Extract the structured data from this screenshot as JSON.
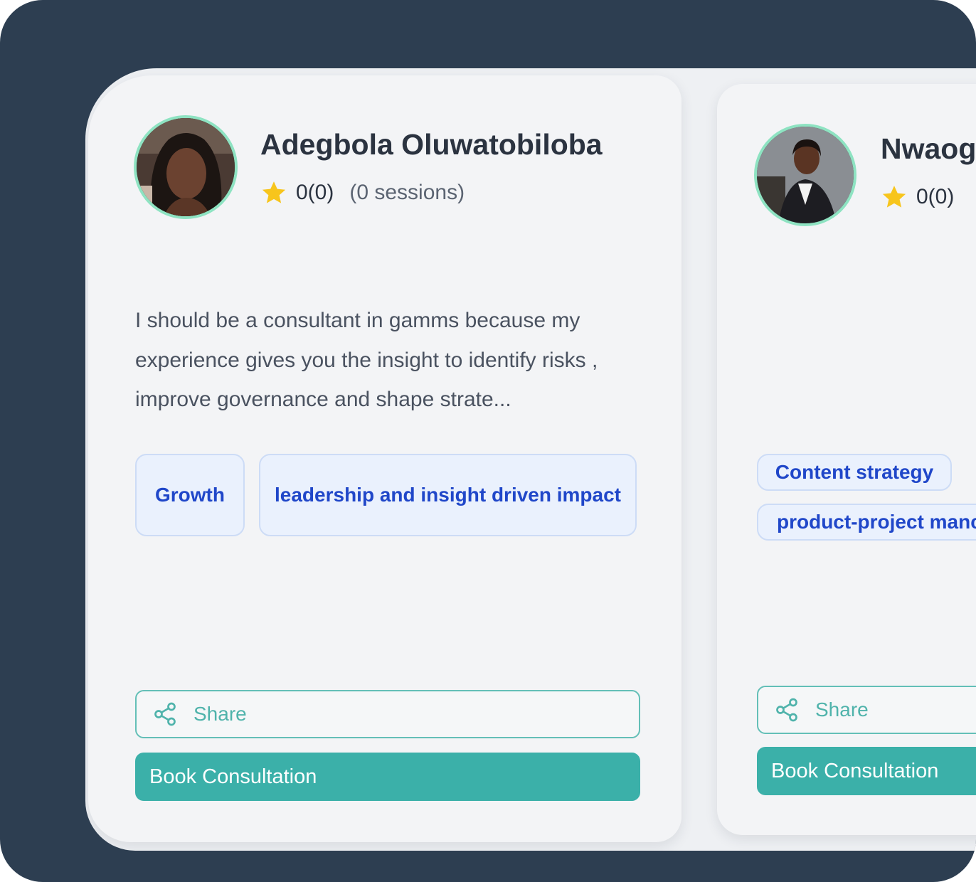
{
  "consultants": [
    {
      "name": "Adegbola Oluwatobiloba",
      "rating": "0(0)",
      "sessions": "(0 sessions)",
      "bio": "I should be a consultant in gamms because my experience gives you the insight to identify risks , improve governance and shape strate...",
      "tags": [
        "Growth",
        "leadership and insight driven impact"
      ],
      "share_label": "Share",
      "book_label": "Book Consultation"
    },
    {
      "name": "Nwaog",
      "rating": "0(0)",
      "tags": [
        "Content strategy",
        "product-project manc"
      ],
      "share_label": "Share",
      "book_label": "Book Consultation"
    }
  ],
  "colors": {
    "background": "#2d3e51",
    "accent": "#3bb0a9",
    "tag_text": "#2047c9",
    "avatar_ring": "#8ee3c2",
    "star": "#f7c51c"
  },
  "icons": {
    "star": "star-icon",
    "share": "share-icon"
  }
}
